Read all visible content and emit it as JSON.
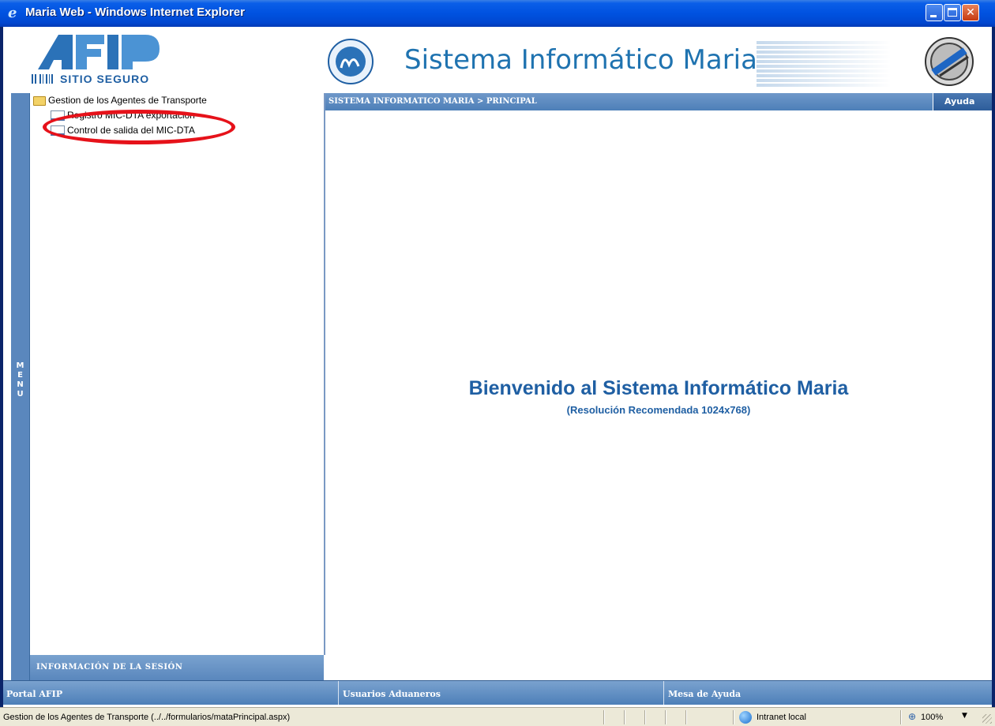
{
  "window": {
    "title": "Maria Web - Windows Internet Explorer"
  },
  "header": {
    "afip_tagline": "SITIO SEGURO",
    "system_title": "Sistema Informático Maria"
  },
  "sidebar": {
    "vertical_label": [
      "M",
      "E",
      "N",
      "U"
    ],
    "tree": [
      {
        "label": "Gestion de los Agentes de Transporte",
        "type": "folder"
      },
      {
        "label": "Registro MIC-DTA exportacion",
        "type": "page"
      },
      {
        "label": "Control de salida del MIC-DTA",
        "type": "page"
      }
    ],
    "session_label": "INFORMACIÓN DE LA SESIÓN"
  },
  "main": {
    "breadcrumb": "SISTEMA INFORMATICO MARIA > PRINCIPAL",
    "help_label": "Ayuda",
    "welcome": "Bienvenido al Sistema Informático Maria",
    "resolution_note": "(Resolución Recomendada 1024x768)"
  },
  "footer": {
    "links": [
      "Portal AFIP",
      "Usuarios Aduaneros",
      "Mesa de Ayuda"
    ]
  },
  "statusbar": {
    "text": "Gestion de los Agentes de Transporte (../../formularios/mataPrincipal.aspx)",
    "zone": "Intranet local",
    "zoom": "100%"
  },
  "colors": {
    "accent": "#1f5fa3",
    "menu_bar": "#5a87bd",
    "annotation": "#e6121a"
  }
}
